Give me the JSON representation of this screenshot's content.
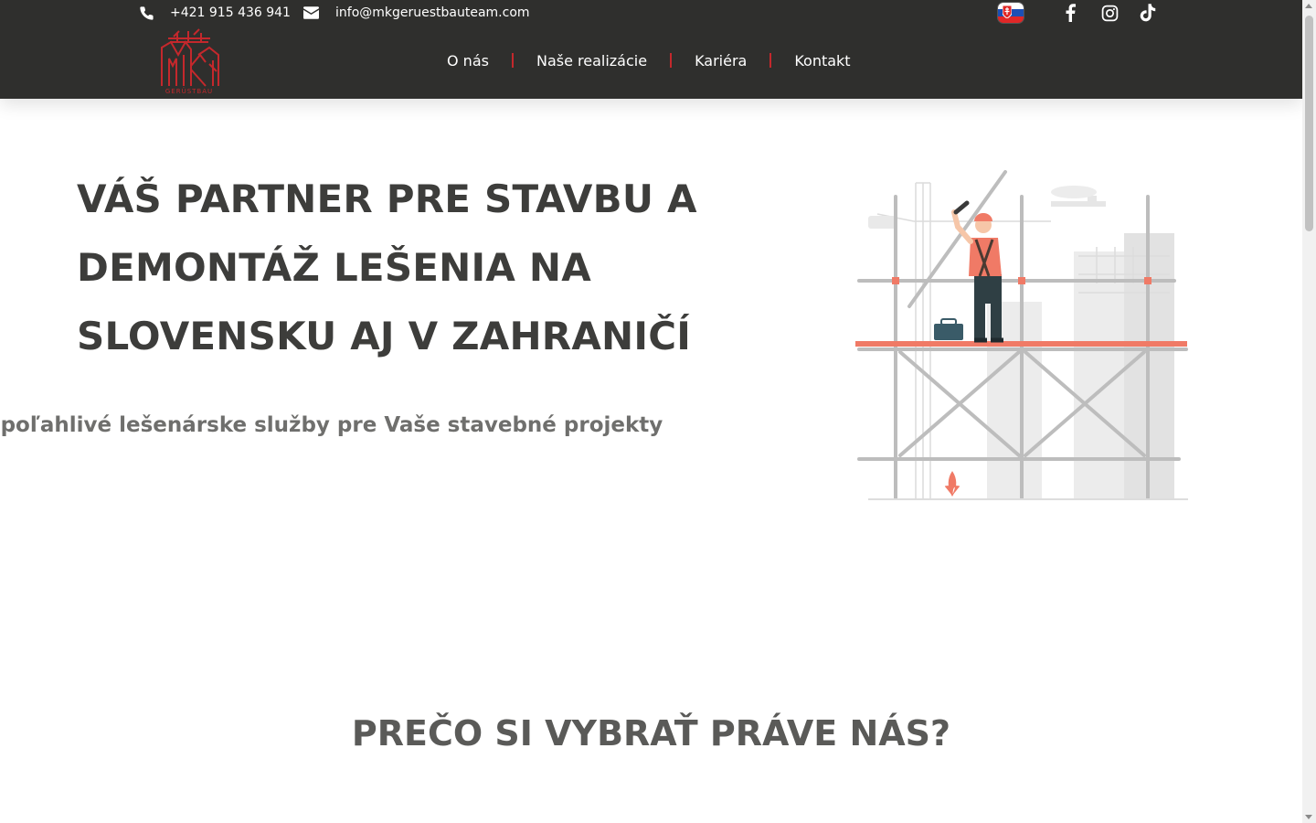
{
  "topbar": {
    "phone": "+421 915 436 941",
    "email": "info@mkgeruestbauteam.com",
    "icons": {
      "phone": "phone-icon",
      "email": "envelope-icon",
      "facebook": "facebook-icon",
      "instagram": "instagram-icon",
      "tiktok": "tiktok-icon",
      "language": "slovak-flag-icon"
    }
  },
  "logo": {
    "text": "GERÜSTBAU",
    "color": "#c4282c"
  },
  "nav": {
    "items": [
      {
        "label": "O nás"
      },
      {
        "label": "Naše realizácie"
      },
      {
        "label": "Kariéra"
      },
      {
        "label": "Kontakt"
      }
    ],
    "separator_color": "#c4282c"
  },
  "hero": {
    "title": "VÁŠ PARTNER PRE STAVBU A DEMONTÁŽ LEŠENIA NA SLOVENSKU AJ V ZAHRANIČÍ",
    "subtitle": "Spoľahlivé lešenárske služby pre Vaše stavebné projekty"
  },
  "why": {
    "title": "PREČO SI VYBRAŤ PRÁVE NÁS?"
  },
  "colors": {
    "header_bg": "#2f2f2d",
    "accent": "#c4282c",
    "text_dark": "#3d3d3b",
    "text_muted": "#6f6f6d"
  }
}
